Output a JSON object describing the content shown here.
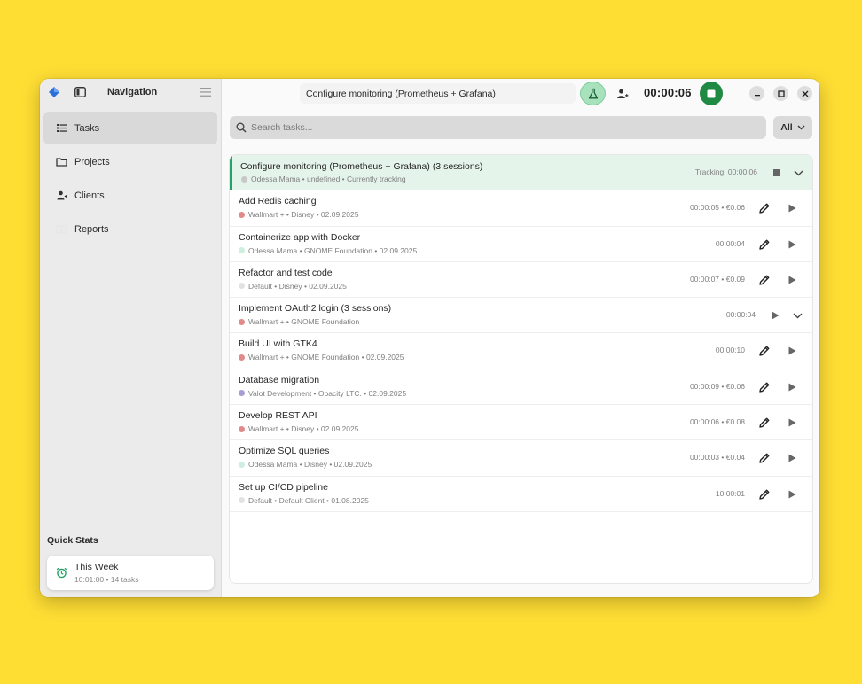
{
  "sidebar": {
    "title": "Navigation",
    "items": [
      {
        "label": "Tasks",
        "icon": "list-icon"
      },
      {
        "label": "Projects",
        "icon": "folder-icon"
      },
      {
        "label": "Clients",
        "icon": "person-icon"
      },
      {
        "label": "Reports",
        "icon": "chart-icon"
      }
    ],
    "quick_stats": {
      "title": "Quick Stats",
      "card_title": "This Week",
      "card_sub": "10:01:00 • 14 tasks"
    }
  },
  "header": {
    "current_task": "Configure monitoring (Prometheus + Grafana)",
    "timer": "00:00:06"
  },
  "search": {
    "placeholder": "Search tasks...",
    "filter": "All"
  },
  "colors": {
    "accent": "#26a269",
    "tracking_bg": "#e5f4ea",
    "background": "#FFDE34"
  },
  "tasks": [
    {
      "title": "Configure monitoring (Prometheus + Grafana) (3 sessions)",
      "meta": "Odessa Mama • undefined • Currently tracking",
      "dot": "#c8c8c8",
      "stat": "Tracking: 00:00:06",
      "tracking": true
    },
    {
      "title": "Add Redis caching",
      "meta": "Wallmart + • Disney • 02.09.2025",
      "dot": "#e08a8a",
      "stat": "00:00:05 • €0.06"
    },
    {
      "title": "Containerize app with Docker",
      "meta": "Odessa Mama • GNOME Foundation • 02.09.2025",
      "dot": "#cfeee0",
      "stat": "00:00:04"
    },
    {
      "title": "Refactor and test code",
      "meta": "Default • Disney • 02.09.2025",
      "dot": "#e2e2e2",
      "stat": "00:00:07 • €0.09"
    },
    {
      "title": "Implement OAuth2 login (3 sessions)",
      "meta": "Wallmart + • GNOME Foundation",
      "dot": "#e08a8a",
      "stat": "00:00:04",
      "group": true
    },
    {
      "title": "Build UI with GTK4",
      "meta": "Wallmart + • GNOME Foundation • 02.09.2025",
      "dot": "#e08a8a",
      "stat": "00:00:10"
    },
    {
      "title": "Database migration",
      "meta": "Valot Development • Opacity LTC. • 02.09.2025",
      "dot": "#a99bd4",
      "stat": "00:00:09 • €0.06"
    },
    {
      "title": "Develop REST API",
      "meta": "Wallmart + • Disney • 02.09.2025",
      "dot": "#e08a8a",
      "stat": "00:00:06 • €0.08"
    },
    {
      "title": "Optimize SQL queries",
      "meta": "Odessa Mama • Disney • 02.09.2025",
      "dot": "#cfeee0",
      "stat": "00:00:03 • €0.04"
    },
    {
      "title": "Set up CI/CD pipeline",
      "meta": "Default • Default Client • 01.08.2025",
      "dot": "#e2e2e2",
      "stat": "10:00:01"
    }
  ]
}
